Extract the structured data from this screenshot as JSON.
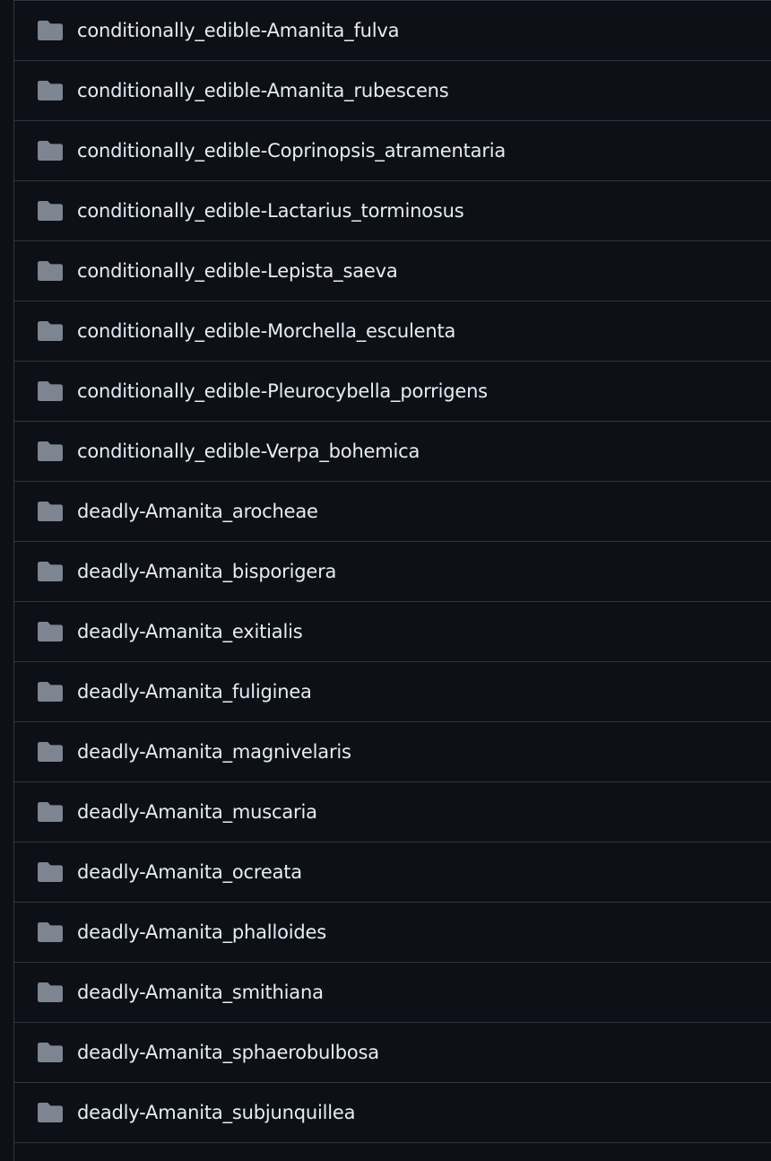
{
  "file_list": {
    "icon": "folder-icon",
    "colors": {
      "background": "#0d1117",
      "border": "#30363d",
      "text": "#e6edf3",
      "icon": "#7d8590"
    },
    "items": [
      {
        "name": "conditionally_edible-Amanita_fulva"
      },
      {
        "name": "conditionally_edible-Amanita_rubescens"
      },
      {
        "name": "conditionally_edible-Coprinopsis_atramentaria"
      },
      {
        "name": "conditionally_edible-Lactarius_torminosus"
      },
      {
        "name": "conditionally_edible-Lepista_saeva"
      },
      {
        "name": "conditionally_edible-Morchella_esculenta"
      },
      {
        "name": "conditionally_edible-Pleurocybella_porrigens"
      },
      {
        "name": "conditionally_edible-Verpa_bohemica"
      },
      {
        "name": "deadly-Amanita_arocheae"
      },
      {
        "name": "deadly-Amanita_bisporigera"
      },
      {
        "name": "deadly-Amanita_exitialis"
      },
      {
        "name": "deadly-Amanita_fuliginea"
      },
      {
        "name": "deadly-Amanita_magnivelaris"
      },
      {
        "name": "deadly-Amanita_muscaria"
      },
      {
        "name": "deadly-Amanita_ocreata"
      },
      {
        "name": "deadly-Amanita_phalloides"
      },
      {
        "name": "deadly-Amanita_smithiana"
      },
      {
        "name": "deadly-Amanita_sphaerobulbosa"
      },
      {
        "name": "deadly-Amanita_subjunquillea"
      }
    ]
  }
}
